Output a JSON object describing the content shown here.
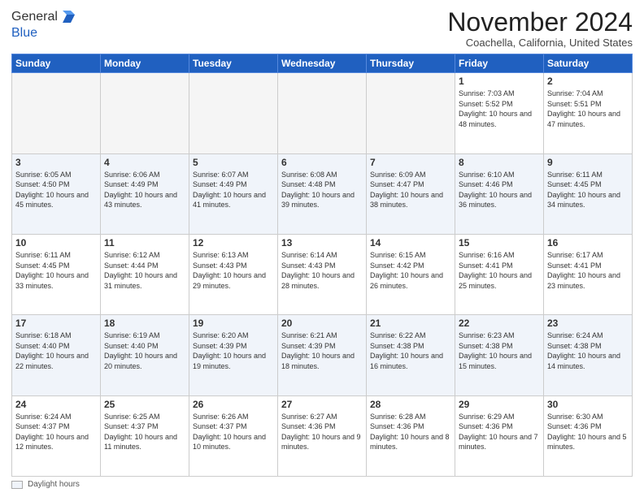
{
  "header": {
    "logo_general": "General",
    "logo_blue": "Blue",
    "month": "November 2024",
    "location": "Coachella, California, United States"
  },
  "calendar": {
    "weekdays": [
      "Sunday",
      "Monday",
      "Tuesday",
      "Wednesday",
      "Thursday",
      "Friday",
      "Saturday"
    ],
    "weeks": [
      [
        {
          "day": "",
          "info": ""
        },
        {
          "day": "",
          "info": ""
        },
        {
          "day": "",
          "info": ""
        },
        {
          "day": "",
          "info": ""
        },
        {
          "day": "",
          "info": ""
        },
        {
          "day": "1",
          "info": "Sunrise: 7:03 AM\nSunset: 5:52 PM\nDaylight: 10 hours and 48 minutes."
        },
        {
          "day": "2",
          "info": "Sunrise: 7:04 AM\nSunset: 5:51 PM\nDaylight: 10 hours and 47 minutes."
        }
      ],
      [
        {
          "day": "3",
          "info": "Sunrise: 6:05 AM\nSunset: 4:50 PM\nDaylight: 10 hours and 45 minutes."
        },
        {
          "day": "4",
          "info": "Sunrise: 6:06 AM\nSunset: 4:49 PM\nDaylight: 10 hours and 43 minutes."
        },
        {
          "day": "5",
          "info": "Sunrise: 6:07 AM\nSunset: 4:49 PM\nDaylight: 10 hours and 41 minutes."
        },
        {
          "day": "6",
          "info": "Sunrise: 6:08 AM\nSunset: 4:48 PM\nDaylight: 10 hours and 39 minutes."
        },
        {
          "day": "7",
          "info": "Sunrise: 6:09 AM\nSunset: 4:47 PM\nDaylight: 10 hours and 38 minutes."
        },
        {
          "day": "8",
          "info": "Sunrise: 6:10 AM\nSunset: 4:46 PM\nDaylight: 10 hours and 36 minutes."
        },
        {
          "day": "9",
          "info": "Sunrise: 6:11 AM\nSunset: 4:45 PM\nDaylight: 10 hours and 34 minutes."
        }
      ],
      [
        {
          "day": "10",
          "info": "Sunrise: 6:11 AM\nSunset: 4:45 PM\nDaylight: 10 hours and 33 minutes."
        },
        {
          "day": "11",
          "info": "Sunrise: 6:12 AM\nSunset: 4:44 PM\nDaylight: 10 hours and 31 minutes."
        },
        {
          "day": "12",
          "info": "Sunrise: 6:13 AM\nSunset: 4:43 PM\nDaylight: 10 hours and 29 minutes."
        },
        {
          "day": "13",
          "info": "Sunrise: 6:14 AM\nSunset: 4:43 PM\nDaylight: 10 hours and 28 minutes."
        },
        {
          "day": "14",
          "info": "Sunrise: 6:15 AM\nSunset: 4:42 PM\nDaylight: 10 hours and 26 minutes."
        },
        {
          "day": "15",
          "info": "Sunrise: 6:16 AM\nSunset: 4:41 PM\nDaylight: 10 hours and 25 minutes."
        },
        {
          "day": "16",
          "info": "Sunrise: 6:17 AM\nSunset: 4:41 PM\nDaylight: 10 hours and 23 minutes."
        }
      ],
      [
        {
          "day": "17",
          "info": "Sunrise: 6:18 AM\nSunset: 4:40 PM\nDaylight: 10 hours and 22 minutes."
        },
        {
          "day": "18",
          "info": "Sunrise: 6:19 AM\nSunset: 4:40 PM\nDaylight: 10 hours and 20 minutes."
        },
        {
          "day": "19",
          "info": "Sunrise: 6:20 AM\nSunset: 4:39 PM\nDaylight: 10 hours and 19 minutes."
        },
        {
          "day": "20",
          "info": "Sunrise: 6:21 AM\nSunset: 4:39 PM\nDaylight: 10 hours and 18 minutes."
        },
        {
          "day": "21",
          "info": "Sunrise: 6:22 AM\nSunset: 4:38 PM\nDaylight: 10 hours and 16 minutes."
        },
        {
          "day": "22",
          "info": "Sunrise: 6:23 AM\nSunset: 4:38 PM\nDaylight: 10 hours and 15 minutes."
        },
        {
          "day": "23",
          "info": "Sunrise: 6:24 AM\nSunset: 4:38 PM\nDaylight: 10 hours and 14 minutes."
        }
      ],
      [
        {
          "day": "24",
          "info": "Sunrise: 6:24 AM\nSunset: 4:37 PM\nDaylight: 10 hours and 12 minutes."
        },
        {
          "day": "25",
          "info": "Sunrise: 6:25 AM\nSunset: 4:37 PM\nDaylight: 10 hours and 11 minutes."
        },
        {
          "day": "26",
          "info": "Sunrise: 6:26 AM\nSunset: 4:37 PM\nDaylight: 10 hours and 10 minutes."
        },
        {
          "day": "27",
          "info": "Sunrise: 6:27 AM\nSunset: 4:36 PM\nDaylight: 10 hours and 9 minutes."
        },
        {
          "day": "28",
          "info": "Sunrise: 6:28 AM\nSunset: 4:36 PM\nDaylight: 10 hours and 8 minutes."
        },
        {
          "day": "29",
          "info": "Sunrise: 6:29 AM\nSunset: 4:36 PM\nDaylight: 10 hours and 7 minutes."
        },
        {
          "day": "30",
          "info": "Sunrise: 6:30 AM\nSunset: 4:36 PM\nDaylight: 10 hours and 5 minutes."
        }
      ]
    ]
  },
  "legend": {
    "label": "Daylight hours"
  }
}
